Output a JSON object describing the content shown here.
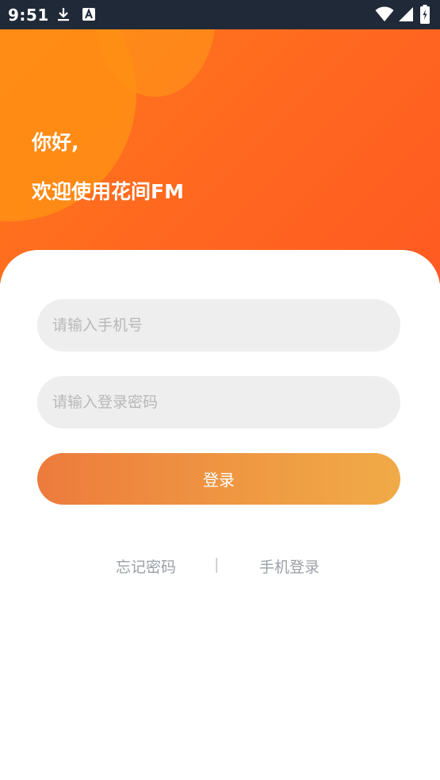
{
  "status_bar": {
    "time": "9:51",
    "icons": [
      "download-icon",
      "a-icon",
      "wifi-icon",
      "signal-icon",
      "battery-icon"
    ]
  },
  "header": {
    "greeting_line1": "你好,",
    "greeting_line2": "欢迎使用花间FM",
    "accent_colors": [
      "#ff7a1a",
      "#ff5a22"
    ]
  },
  "form": {
    "phone_placeholder": "请输入手机号",
    "phone_value": "",
    "password_placeholder": "请输入登录密码",
    "password_value": "",
    "login_label": "登录",
    "login_gradient": [
      "#ed7b3c",
      "#f0aa47"
    ]
  },
  "links": {
    "forgot_password": "忘记密码",
    "separator": "|",
    "phone_login": "手机登录"
  }
}
